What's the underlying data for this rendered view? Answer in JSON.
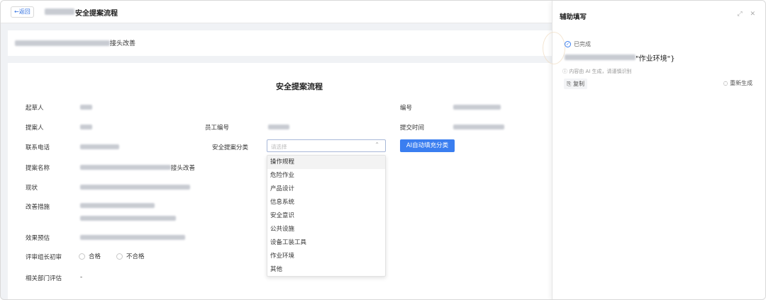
{
  "header": {
    "back_label": "←返回",
    "title": "安全提案流程"
  },
  "subtitle": {
    "visible_suffix": "接头改善"
  },
  "form": {
    "title": "安全提案流程",
    "labels": {
      "drafter": "起草人",
      "proposer": "提案人",
      "phone": "联系电话",
      "proposal_name": "提案名称",
      "status": "现状",
      "measures": "改善措施",
      "effect": "效果预估",
      "review": "评审组长初审",
      "dept_eval": "相关部门评估",
      "employee_id": "员工编号",
      "category": "安全提案分类",
      "number": "编号",
      "submit_time": "提交时间"
    },
    "values": {
      "proposal_name_suffix": "接头改善",
      "dept_eval": "-"
    },
    "category_select": {
      "placeholder": "请选择",
      "arrow": "⌃"
    },
    "ai_button": "AI自动填充分类",
    "dropdown_options": [
      "操作规程",
      "危险作业",
      "产品设计",
      "信息系统",
      "安全意识",
      "公共设施",
      "设备工装工具",
      "作业环境",
      "其他"
    ],
    "review_options": [
      "合格",
      "不合格"
    ]
  },
  "assist_panel": {
    "title": "辅助填写",
    "icons": "⤢ ✕",
    "status": "已完成",
    "status_icon": "✓",
    "result_suffix": "\"作业环境\"}",
    "note": "ⓘ 内容由 AI 生成，请谨慎识别",
    "copy_label": "⎘ 复制",
    "regen_label": "◌ 重新生成"
  }
}
